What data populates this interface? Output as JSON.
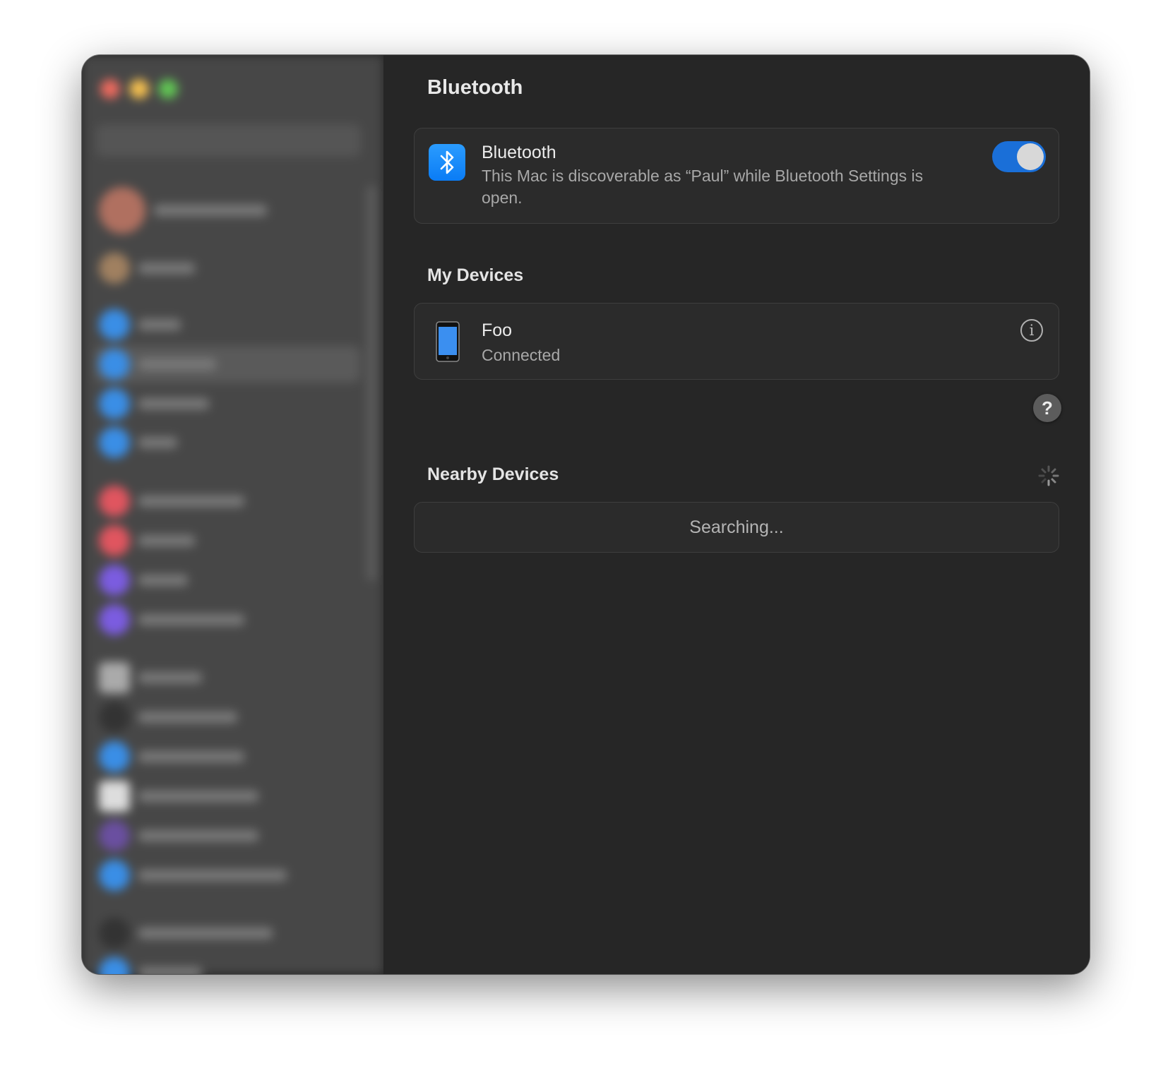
{
  "window": {
    "traffic_lights": {
      "close": "#ec6a5e",
      "minimize": "#f4bf4f",
      "zoom": "#61c554"
    }
  },
  "header": {
    "title": "Bluetooth"
  },
  "bluetooth": {
    "icon": "bluetooth-icon",
    "label": "Bluetooth",
    "description": "This Mac is discoverable as “Paul” while Bluetooth Settings is open.",
    "enabled": true,
    "accent": "#1a6fd8"
  },
  "my_devices": {
    "title": "My Devices",
    "items": [
      {
        "name": "Foo",
        "status": "Connected",
        "icon": "iphone-icon"
      }
    ]
  },
  "help": {
    "label": "?"
  },
  "nearby_devices": {
    "title": "Nearby Devices",
    "status": "Searching..."
  }
}
